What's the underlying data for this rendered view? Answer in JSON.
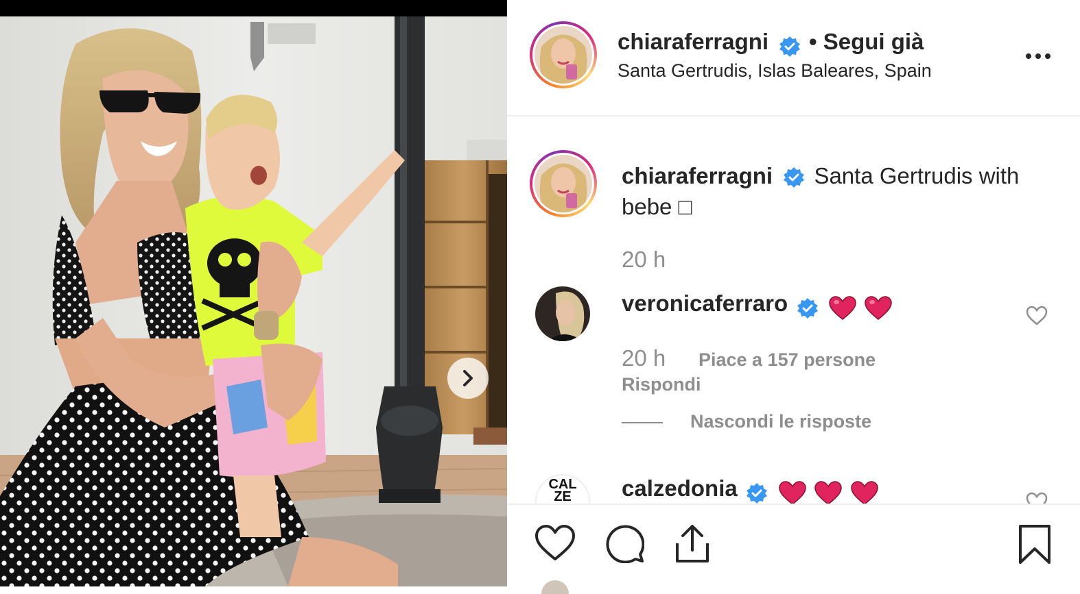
{
  "post": {
    "username": "chiaraferragni",
    "follow_status": "• Segui già",
    "location": "Santa Gertrudis, Islas Baleares, Spain",
    "caption": "Santa Gertrudis with bebe □",
    "caption_time": "20 h"
  },
  "comments": [
    {
      "username": "veronicaferraro",
      "hearts": 2,
      "time": "20 h",
      "likes": "Piace a 157 persone",
      "reply": "Rispondi",
      "hide_replies": "Nascondi le risposte"
    },
    {
      "username": "calzedonia",
      "avatar_text": "CAL ZE",
      "hearts": 3
    }
  ],
  "icons": {
    "verified": "verified-badge-icon",
    "more": "more-options-icon",
    "next": "chevron-right-icon",
    "like": "heart-icon",
    "comment": "comment-icon",
    "share": "share-icon",
    "save": "bookmark-icon"
  },
  "colors": {
    "verified_blue": "#3897f0",
    "heart_red": "#e0245e",
    "muted_text": "#8e8e8e"
  }
}
